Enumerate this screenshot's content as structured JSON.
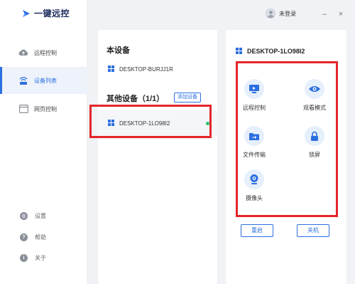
{
  "app": {
    "name": "一键远控"
  },
  "sidebar": {
    "items": [
      {
        "label": "远程控制",
        "icon": "cloud-icon"
      },
      {
        "label": "设备列表",
        "icon": "device-list-icon"
      },
      {
        "label": "网页控制",
        "icon": "webpage-icon"
      }
    ],
    "active_index": 1,
    "bottom": [
      {
        "label": "设置",
        "icon": "gear-icon"
      },
      {
        "label": "帮助",
        "icon": "help-icon"
      },
      {
        "label": "关于",
        "icon": "info-icon"
      }
    ]
  },
  "topbar": {
    "user_label": "未登录",
    "minimize": "–",
    "close": "×"
  },
  "local": {
    "title": "本设备",
    "device_name": "DESKTOP-BURJJ1R"
  },
  "others": {
    "title": "其他设备（1/1）",
    "add_label": "添加设备",
    "device_name": "DESKTOP-1LO98I2",
    "status": "online"
  },
  "detail": {
    "device_name": "DESKTOP-1LO98I2",
    "functions": [
      {
        "label": "远程控制",
        "icon": "remote-control-icon"
      },
      {
        "label": "观看模式",
        "icon": "eye-icon"
      },
      {
        "label": "文件传输",
        "icon": "folder-icon"
      },
      {
        "label": "锁屏",
        "icon": "lock-icon"
      },
      {
        "label": "摄像头",
        "icon": "camera-icon"
      }
    ],
    "restart_label": "重启",
    "shutdown_label": "关机"
  },
  "colors": {
    "accent": "#2c6fe0",
    "highlight": "#e5252a",
    "online": "#2ac36b"
  }
}
